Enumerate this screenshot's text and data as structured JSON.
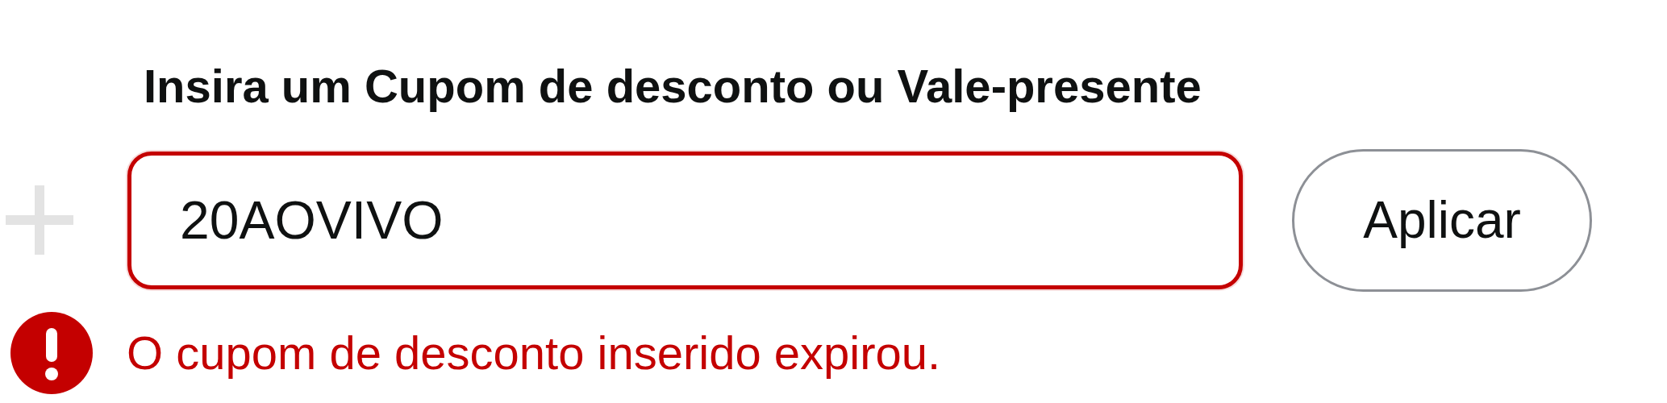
{
  "heading": "Insira um Cupom de desconto ou Vale-presente",
  "coupon_field": {
    "value": "20AOVIVO",
    "error": true
  },
  "apply_button": "Aplicar",
  "error_message": "O cupom de desconto inserido expirou."
}
